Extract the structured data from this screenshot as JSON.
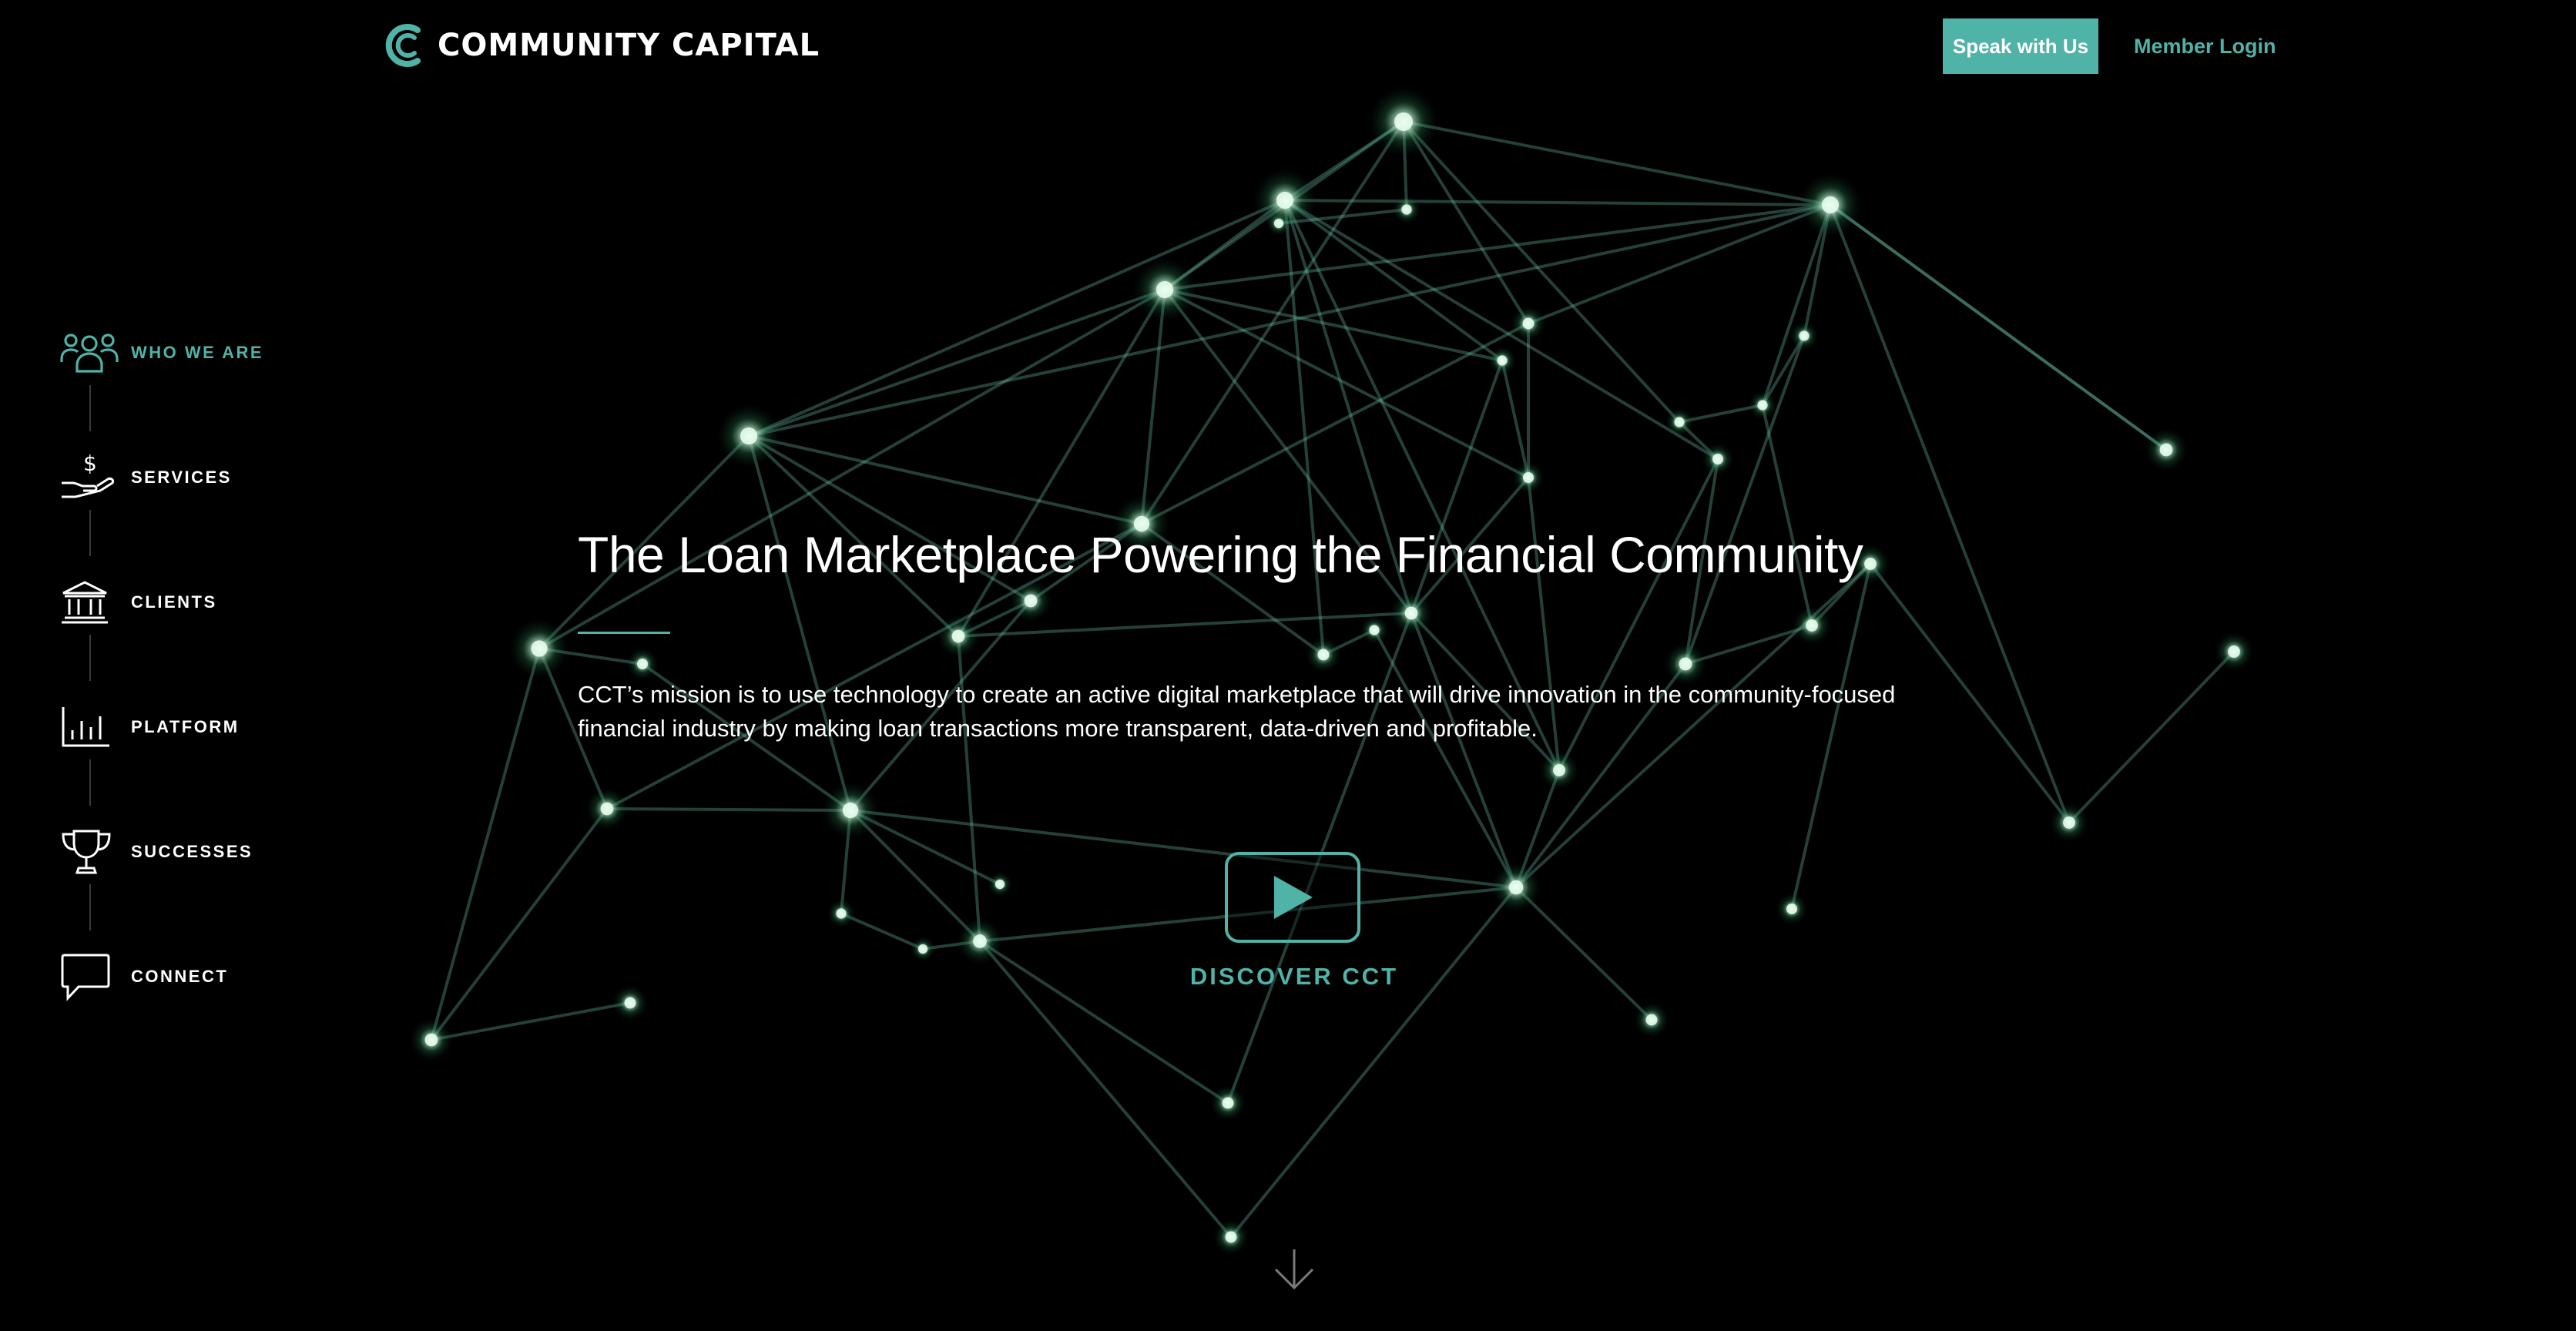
{
  "header": {
    "brand": "COMMUNITY CAPITAL",
    "speak_label": "Speak with Us",
    "login_label": "Member Login"
  },
  "sidenav": {
    "items": [
      {
        "label": "WHO WE ARE",
        "icon": "people-icon",
        "active": true
      },
      {
        "label": "SERVICES",
        "icon": "dollar-hand-icon",
        "active": false
      },
      {
        "label": "CLIENTS",
        "icon": "bank-icon",
        "active": false
      },
      {
        "label": "PLATFORM",
        "icon": "bar-chart-icon",
        "active": false
      },
      {
        "label": "SUCCESSES",
        "icon": "trophy-icon",
        "active": false
      },
      {
        "label": "CONNECT",
        "icon": "speech-bubble-icon",
        "active": false
      }
    ]
  },
  "hero": {
    "title": "The Loan Marketplace Powering the Financial Community",
    "description": "CCT’s mission is to use technology to create an active digital marketplace that will drive innovation in the community-focused financial industry by making loan transactions more transparent, data-driven and profitable.",
    "discover_label": "DISCOVER CCT"
  },
  "colors": {
    "accent": "#4fb3a7",
    "background": "#000000",
    "text": "#ffffff"
  }
}
